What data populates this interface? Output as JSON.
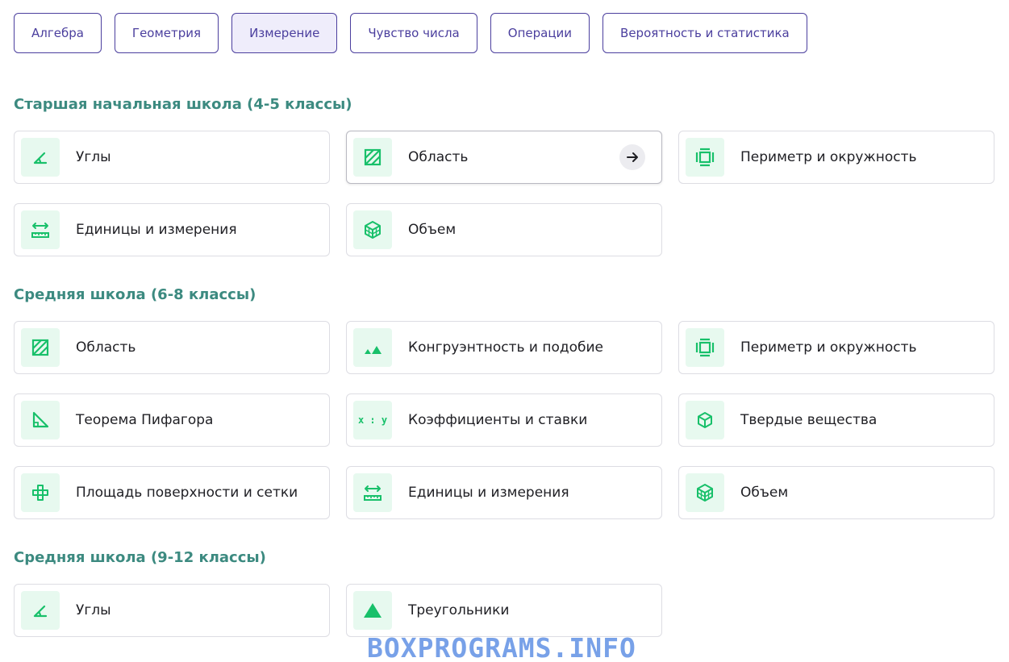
{
  "tabs": [
    {
      "label": "Алгебра"
    },
    {
      "label": "Геометрия"
    },
    {
      "label": "Измерение"
    },
    {
      "label": "Чувство числа"
    },
    {
      "label": "Операции"
    },
    {
      "label": "Вероятность и статистика"
    }
  ],
  "active_tab": "Измерение",
  "sections": [
    {
      "title": "Старшая начальная школа (4-5 классы)",
      "items": [
        {
          "label": "Углы",
          "icon": "angle-icon"
        },
        {
          "label": "Область",
          "icon": "area-icon"
        },
        {
          "label": "Периметр и окружность",
          "icon": "perimeter-icon"
        },
        {
          "label": "Единицы и измерения",
          "icon": "ruler-icon"
        },
        {
          "label": "Объем",
          "icon": "cube-grid-icon"
        }
      ]
    },
    {
      "title": "Средняя школа (6-8 классы)",
      "items": [
        {
          "label": "Область",
          "icon": "area-icon"
        },
        {
          "label": "Конгруэнтность и подобие",
          "icon": "similar-triangles-icon"
        },
        {
          "label": "Периметр и окружность",
          "icon": "perimeter-icon"
        },
        {
          "label": "Теорема Пифагора",
          "icon": "right-triangle-icon"
        },
        {
          "label": "Коэффициенты и ставки",
          "icon": "ratio-icon"
        },
        {
          "label": "Твердые вещества",
          "icon": "cube-icon"
        },
        {
          "label": "Площадь поверхности и сетки",
          "icon": "net-icon"
        },
        {
          "label": "Единицы и измерения",
          "icon": "ruler-icon"
        },
        {
          "label": "Объем",
          "icon": "cube-grid-icon"
        }
      ]
    },
    {
      "title": "Средняя школа (9-12 классы)",
      "items": [
        {
          "label": "Углы",
          "icon": "angle-icon"
        },
        {
          "label": "Треугольники",
          "icon": "triangle-icon"
        }
      ]
    }
  ],
  "ratio_icon_text": "x : y",
  "watermark": "BOXPROGRAMS.INFO",
  "colors": {
    "accent": "#4b3f9e",
    "section_title": "#3c8a80",
    "icon_green": "#18c06a",
    "icon_bg": "#e7f9ef"
  }
}
